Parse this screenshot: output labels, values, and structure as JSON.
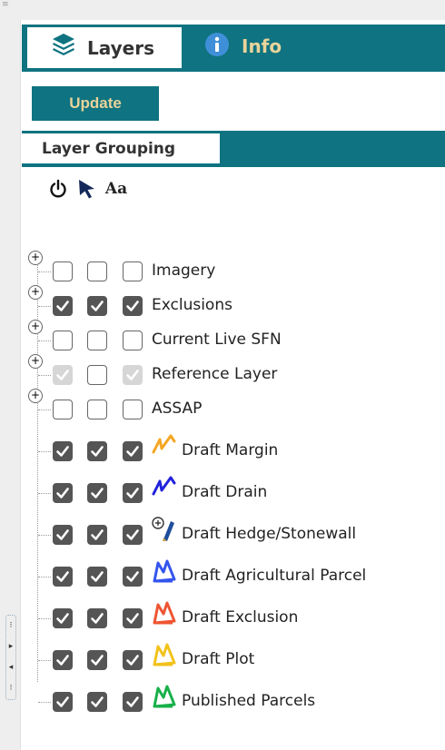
{
  "tabs": [
    {
      "label": "Layers",
      "icon": "layers-icon",
      "active": true
    },
    {
      "label": "Info",
      "icon": "info-icon",
      "active": false
    }
  ],
  "update_button": {
    "label": "Update"
  },
  "layer_grouping_tab": {
    "label": "Layer Grouping"
  },
  "tools": [
    {
      "name": "power-icon"
    },
    {
      "name": "select-arrow-icon"
    },
    {
      "name": "text-icon",
      "text": "Aa"
    }
  ],
  "layers": [
    {
      "label": "Imagery",
      "expandable": true,
      "checks": [
        "unchecked",
        "unchecked",
        "unchecked"
      ],
      "icon": null
    },
    {
      "label": "Exclusions",
      "expandable": true,
      "checks": [
        "checked",
        "checked",
        "checked"
      ],
      "icon": null
    },
    {
      "label": "Current Live SFN",
      "expandable": true,
      "checks": [
        "unchecked",
        "unchecked",
        "unchecked"
      ],
      "icon": null
    },
    {
      "label": "Reference Layer",
      "expandable": true,
      "checks": [
        "disabled",
        "unchecked",
        "disabled"
      ],
      "icon": null
    },
    {
      "label": "ASSAP",
      "expandable": true,
      "checks": [
        "unchecked",
        "unchecked",
        "unchecked"
      ],
      "icon": null
    },
    {
      "label": "Draft Margin",
      "expandable": false,
      "checks": [
        "checked",
        "checked",
        "checked"
      ],
      "icon": "line-symbol-icon",
      "color": "#f5a623"
    },
    {
      "label": "Draft Drain",
      "expandable": false,
      "checks": [
        "checked",
        "checked",
        "checked"
      ],
      "icon": "line-symbol-icon",
      "color": "#2222dd"
    },
    {
      "label": "Draft Hedge/Stonewall",
      "expandable": false,
      "checks": [
        "checked",
        "checked",
        "checked"
      ],
      "icon": "pen-symbol-icon",
      "color": "#1f4e9c"
    },
    {
      "label": "Draft Agricultural Parcel",
      "expandable": false,
      "checks": [
        "checked",
        "checked",
        "checked"
      ],
      "icon": "polygon-symbol-icon",
      "color": "#3355ee"
    },
    {
      "label": "Draft Exclusion",
      "expandable": false,
      "checks": [
        "checked",
        "checked",
        "checked"
      ],
      "icon": "polygon-symbol-icon",
      "color": "#ee5533"
    },
    {
      "label": "Draft Plot",
      "expandable": false,
      "checks": [
        "checked",
        "checked",
        "checked"
      ],
      "icon": "polygon-symbol-icon",
      "color": "#f2c21b"
    },
    {
      "label": "Published Parcels",
      "expandable": false,
      "checks": [
        "checked",
        "checked",
        "checked"
      ],
      "icon": "polygon-symbol-icon",
      "color": "#18b04a"
    }
  ],
  "colors": {
    "accent": "#0f7381",
    "tab_text": "#e8d39a",
    "check": "#555555"
  }
}
